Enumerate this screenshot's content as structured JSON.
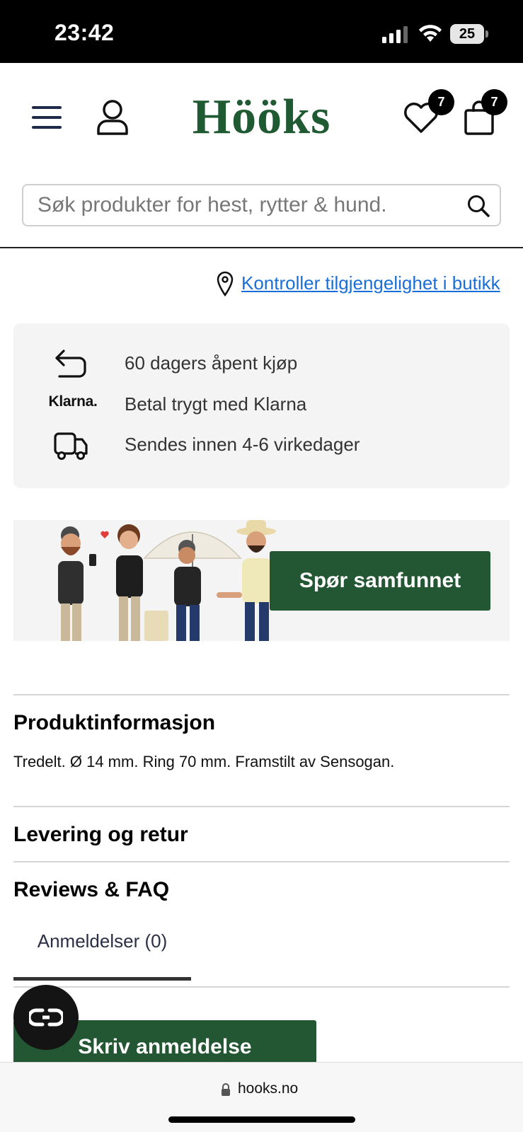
{
  "status_bar": {
    "time": "23:42",
    "battery_level": "25",
    "icons": [
      "signal-icon",
      "wifi-icon",
      "battery-icon"
    ]
  },
  "header": {
    "logo_text": "Hööks",
    "wishlist_count": "7",
    "cart_count": "7",
    "icons": [
      "menu-icon",
      "account-icon",
      "heart-icon",
      "bag-icon"
    ],
    "brand_color": "#1f5a33"
  },
  "search": {
    "placeholder": "Søk produkter for hest, rytter & hund.",
    "value": ""
  },
  "store_availability": {
    "link_text": "Kontroller tilgjengelighet i butikk",
    "link_color": "#1a6ed8"
  },
  "usps": [
    {
      "icon": "return-arrow-icon",
      "text": "60 dagers åpent kjøp"
    },
    {
      "icon": "klarna-logo",
      "logo_text": "Klarna.",
      "text": "Betal trygt med Klarna"
    },
    {
      "icon": "delivery-truck-icon",
      "text": "Sendes innen 4-6 virkedager"
    }
  ],
  "community": {
    "button_label": "Spør samfunnet",
    "button_color": "#235632"
  },
  "product_info": {
    "title": "Produktinformasjon",
    "description": "Tredelt. Ø 14 mm. Ring 70 mm. Framstilt av Sensogan."
  },
  "delivery": {
    "title": "Levering og retur"
  },
  "reviews": {
    "title": "Reviews & FAQ",
    "tab_label": "Anmeldelser (0)",
    "write_button": "Skriv anmeldelse"
  },
  "chat": {
    "icon": "chat-glasses-icon"
  },
  "browser": {
    "url": "hooks.no"
  }
}
